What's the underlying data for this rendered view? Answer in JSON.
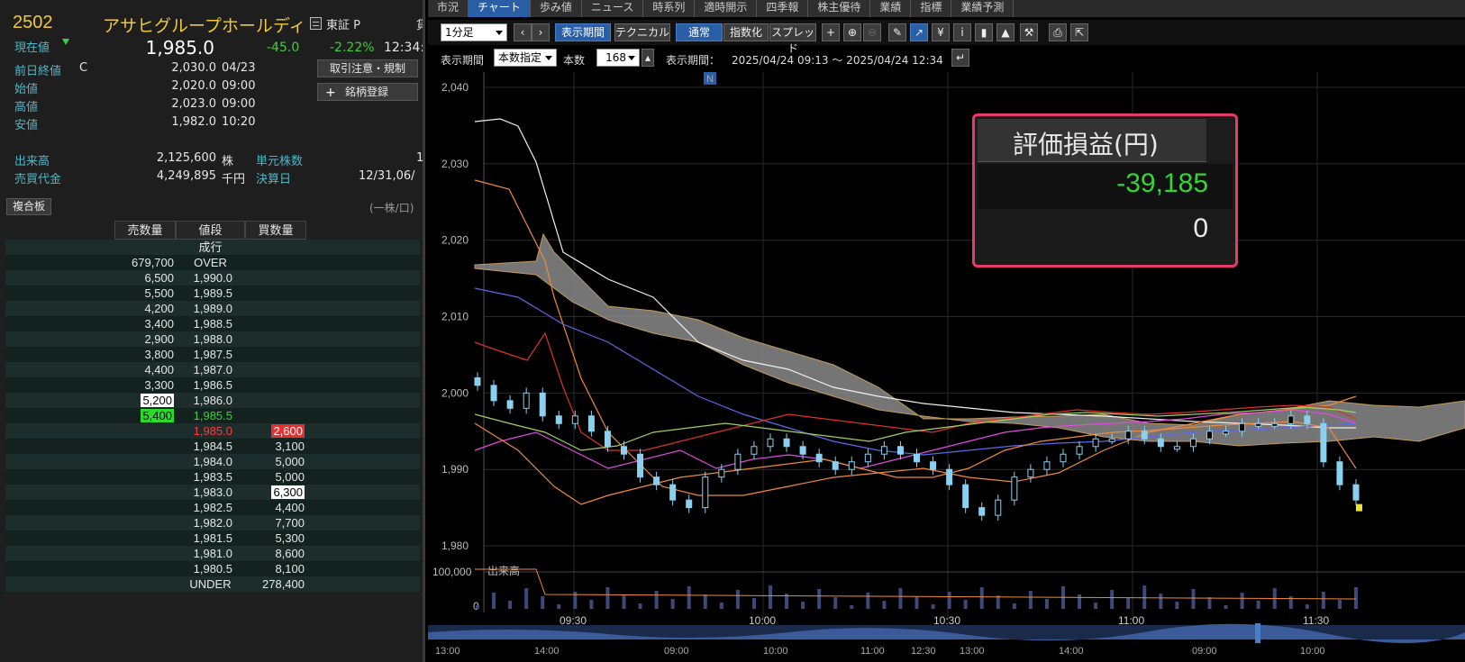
{
  "quote": {
    "code": "2502",
    "name": "アサヒグループホールディン",
    "market": "東証 P",
    "market_cut": "貸",
    "current_label": "現在値",
    "current_price": "1,985.0",
    "change": "-45.0",
    "change_pct": "-2.22%",
    "current_time": "12:34:",
    "prev_close_label": "前日終値",
    "prev_close_flag": "C",
    "prev_close": "2,030.0",
    "prev_close_date": "04/23",
    "open_label": "始値",
    "open": "2,020.0",
    "open_time": "09:00",
    "high_label": "高値",
    "high": "2,023.0",
    "high_time": "09:00",
    "low_label": "安値",
    "low": "1,982.0",
    "low_time": "10:20",
    "volume_label": "出来高",
    "volume": "2,125,600",
    "volume_unit": "株",
    "unit_shares_label": "単元株数",
    "unit_shares": "1",
    "turnover_label": "売買代金",
    "turnover": "4,249,895",
    "turnover_unit": "千円",
    "settlement_label": "決算日",
    "settlement": "12/31,06/",
    "btn_trade_rules": "取引注意・規制",
    "btn_register": "銘柄登録",
    "colors": {
      "accent_yellow": "#f0c93a",
      "down_green": "#3ad13a",
      "up_red": "#ff3c3c"
    }
  },
  "board": {
    "tab_label": "複合板",
    "unit_note": "(一株/口)",
    "headers": [
      "",
      "売数量",
      "値段",
      "買数量",
      ""
    ],
    "rows": [
      {
        "sell": "",
        "price": "成行",
        "buy": ""
      },
      {
        "sell": "679,700",
        "price": "OVER",
        "buy": ""
      },
      {
        "sell": "6,500",
        "price": "1,990.0",
        "buy": ""
      },
      {
        "sell": "5,500",
        "price": "1,989.5",
        "buy": ""
      },
      {
        "sell": "4,200",
        "price": "1,989.0",
        "buy": ""
      },
      {
        "sell": "3,400",
        "price": "1,988.5",
        "buy": ""
      },
      {
        "sell": "2,900",
        "price": "1,988.0",
        "buy": ""
      },
      {
        "sell": "3,800",
        "price": "1,987.5",
        "buy": ""
      },
      {
        "sell": "4,400",
        "price": "1,987.0",
        "buy": ""
      },
      {
        "sell": "3,300",
        "price": "1,986.5",
        "buy": ""
      },
      {
        "sell": "5,200",
        "price": "1,986.0",
        "buy": ""
      },
      {
        "sell": "5,400",
        "price": "1,985.5",
        "buy": ""
      },
      {
        "sell": "",
        "price": "1,985.0",
        "buy": "2,600"
      },
      {
        "sell": "",
        "price": "1,984.5",
        "buy": "3,100"
      },
      {
        "sell": "",
        "price": "1,984.0",
        "buy": "5,000"
      },
      {
        "sell": "",
        "price": "1,983.5",
        "buy": "5,000"
      },
      {
        "sell": "",
        "price": "1,983.0",
        "buy": "6,300"
      },
      {
        "sell": "",
        "price": "1,982.5",
        "buy": "4,400"
      },
      {
        "sell": "",
        "price": "1,982.0",
        "buy": "7,700"
      },
      {
        "sell": "",
        "price": "1,981.5",
        "buy": "5,300"
      },
      {
        "sell": "",
        "price": "1,981.0",
        "buy": "8,600"
      },
      {
        "sell": "",
        "price": "1,980.5",
        "buy": "8,100"
      },
      {
        "sell": "",
        "price": "UNDER",
        "buy": "278,400"
      }
    ]
  },
  "tabs": [
    "市況",
    "チャート",
    "歩み値",
    "ニュース",
    "時系列",
    "適時開示",
    "四季報",
    "株主優待",
    "業績",
    "指標",
    "業績予測"
  ],
  "toolbar": {
    "interval": "1分足",
    "btn_period": "表示期間",
    "btn_technical": "テクニカル",
    "btn_normal": "通常",
    "btn_index": "指数化",
    "btn_spread": "スプレッド",
    "icons": [
      "crosshair-icon",
      "zoom-in-icon",
      "zoom-out-icon",
      "pen-icon",
      "cursor-icon",
      "yen-icon",
      "info-icon",
      "candle-icon",
      "area-icon",
      "wrench-icon",
      "print-icon",
      "export-icon"
    ]
  },
  "period": {
    "label": "表示期間",
    "mode": "本数指定",
    "count_label": "本数",
    "count": "168",
    "range_label": "表示期間：",
    "range": "2025/04/24 09:13 ～ 2025/04/24 12:34"
  },
  "pnl_panel": {
    "title": "評価損益(円)",
    "value1": "-39,185",
    "value2": "0"
  },
  "chart_data": {
    "type": "line",
    "title": "",
    "news_marker": "N",
    "volume_label": "出来高",
    "y_ticks": [
      "2,040",
      "2,030",
      "2,020",
      "2,010",
      "2,000",
      "1,990",
      "1,980"
    ],
    "ylim": [
      1976,
      2042
    ],
    "volume_ticks": [
      "100,000",
      "0"
    ],
    "x_ticks": [
      "09:30",
      "10:00",
      "10:30",
      "11:00",
      "11:30"
    ],
    "scrollbar_ticks": [
      "13:00",
      "14:00",
      "09:00",
      "10:00",
      "11:00",
      "12:30",
      "13:00",
      "14:00",
      "09:00",
      "10:00"
    ],
    "grid": true,
    "price_series": {
      "name": "",
      "values": [
        2001,
        1999,
        1998,
        2000,
        1997,
        1996,
        1997,
        1995,
        1993,
        1992,
        1989,
        1988,
        1986,
        1985,
        1989,
        1990,
        1992,
        1993,
        1994,
        1993,
        1992,
        1991,
        1990,
        1991,
        1992,
        1993,
        1992,
        1991,
        1990,
        1988,
        1985,
        1984,
        1986,
        1989,
        1990,
        1991,
        1992,
        1993,
        1994,
        1994,
        1995,
        1994,
        1993,
        1993,
        1994,
        1995,
        1995,
        1996,
        1996,
        1996,
        1997,
        1996,
        1991,
        1988,
        1986
      ]
    },
    "colors": {
      "candle_up": "#8ad0f0",
      "candle_down": "#8ad0f0",
      "cloud": "#8a8a8a",
      "upper_band": "#f08a3a",
      "ma_white": "#cccccc"
    }
  }
}
